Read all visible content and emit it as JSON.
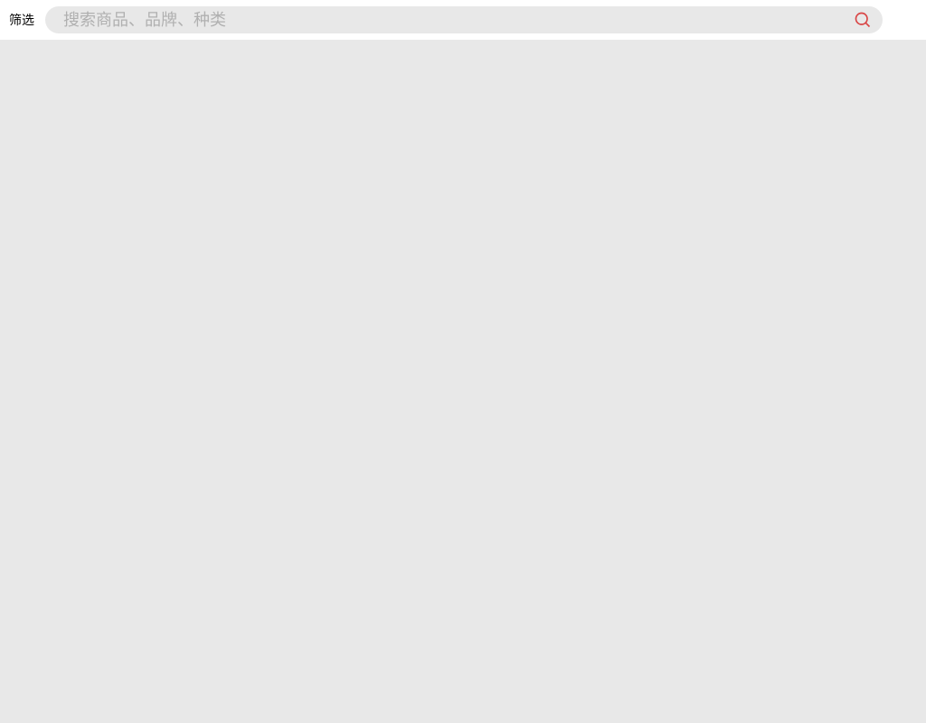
{
  "header": {
    "filter_label": "筛选",
    "search": {
      "placeholder": "搜索商品、品牌、种类",
      "value": ""
    }
  },
  "colors": {
    "accent": "#d94545",
    "background": "#e8e8e8",
    "header_bg": "#ffffff",
    "placeholder": "#b0b0b0"
  }
}
